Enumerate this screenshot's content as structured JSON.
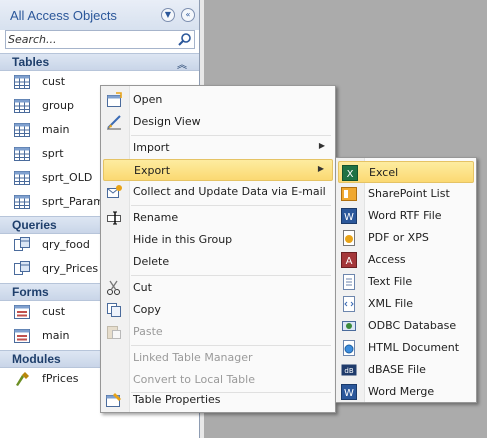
{
  "nav": {
    "title": "All Access Objects",
    "search_placeholder": "Search...",
    "groups": [
      {
        "title": "Tables",
        "items": [
          "cust",
          "group",
          "main",
          "sprt",
          "sprt_OLD",
          "sprt_Param"
        ]
      },
      {
        "title": "Queries",
        "items": [
          "qry_food",
          "qry_Prices"
        ]
      },
      {
        "title": "Forms",
        "items": [
          "cust",
          "main"
        ]
      },
      {
        "title": "Modules",
        "items": [
          "fPrices"
        ]
      }
    ]
  },
  "context_menu": {
    "items": [
      {
        "label": "Open",
        "icon": "open-table-icon"
      },
      {
        "label": "Design View",
        "icon": "design-view-icon"
      },
      {
        "label": "Import",
        "submenu": true
      },
      {
        "label": "Export",
        "submenu": true,
        "highlighted": true
      },
      {
        "label": "Collect and Update Data via E-mail",
        "icon": "collect-data-icon"
      },
      {
        "label": "Rename",
        "icon": "rename-icon"
      },
      {
        "label": "Hide in this Group"
      },
      {
        "label": "Delete"
      },
      {
        "label": "Cut",
        "icon": "scissors-icon"
      },
      {
        "label": "Copy",
        "icon": "copy-icon"
      },
      {
        "label": "Paste",
        "icon": "paste-icon",
        "disabled": true
      },
      {
        "label": "Linked Table Manager",
        "disabled": true
      },
      {
        "label": "Convert to Local Table",
        "disabled": true
      },
      {
        "label": "Table Properties",
        "icon": "table-properties-icon"
      }
    ]
  },
  "export_menu": {
    "items": [
      {
        "label": "Excel",
        "icon": "excel-icon",
        "highlighted": true
      },
      {
        "label": "SharePoint List",
        "icon": "sharepoint-icon"
      },
      {
        "label": "Word RTF File",
        "icon": "word-icon"
      },
      {
        "label": "PDF or XPS",
        "icon": "pdf-icon"
      },
      {
        "label": "Access",
        "icon": "access-icon"
      },
      {
        "label": "Text File",
        "icon": "text-file-icon"
      },
      {
        "label": "XML File",
        "icon": "xml-icon"
      },
      {
        "label": "ODBC Database",
        "icon": "odbc-icon"
      },
      {
        "label": "HTML Document",
        "icon": "html-icon"
      },
      {
        "label": "dBASE File",
        "icon": "dbase-icon"
      },
      {
        "label": "Word Merge",
        "icon": "word-merge-icon"
      }
    ]
  },
  "colors": {
    "highlight": "#fbd972",
    "nav_title": "#2b579a",
    "group_header": "#c9d5e8"
  }
}
